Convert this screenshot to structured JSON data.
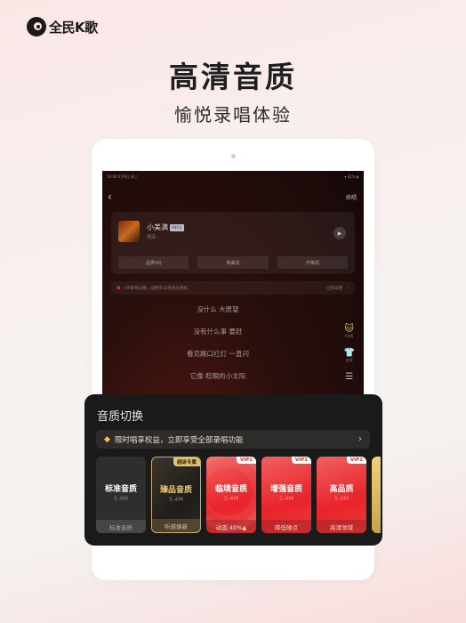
{
  "brand": {
    "logo_icon": "quanmin-k-ge-logo-icon",
    "name": "全民K歌"
  },
  "hero": {
    "title": "高清音质",
    "subtitle": "愉悦录唱体验"
  },
  "device_screen": {
    "status_bar": {
      "left": "10:04 6月9日 周三",
      "right": "▾ 42% ▮"
    },
    "nav": {
      "back_icon": "chevron-left-icon",
      "action": "练唱"
    },
    "song": {
      "title": "小美满",
      "tag": "AI打分",
      "artist": "周深 ›",
      "play_icon": "play-icon",
      "options": [
        "品质HQ",
        "换曲风",
        "升降调"
      ]
    },
    "vip_notice": {
      "text": "VIP即将过期，续费享10项会员特权",
      "action": "立即续费",
      "chevron": "›"
    },
    "lyrics": [
      "没什么 大愿望",
      "没有什么事 要赶",
      "看见路口红灯 一直闪",
      "它像 眨眼的小太阳"
    ],
    "side_tools": [
      {
        "icon": "cat-avatar-icon",
        "label": "KK周"
      },
      {
        "icon": "shirt-icon",
        "label": "皮肤"
      },
      {
        "icon": "menu-icon",
        "label": ""
      }
    ]
  },
  "quality_sheet": {
    "title": "音质切换",
    "promo": {
      "icon": "diamond-icon",
      "text": "限时唱享权益，立即享受全部录唱功能",
      "chevron": "›"
    },
    "options": [
      {
        "name": "标准音质",
        "size": "5.4M",
        "desc": "标准音质",
        "badge": "",
        "style": "standard"
      },
      {
        "name": "臻品音质",
        "size": "5.4M",
        "desc": "听感焕新",
        "badge": "超级专属",
        "style": "gold"
      },
      {
        "name": "临境音质",
        "size": "5.4M",
        "desc": "动态 40%▲",
        "badge": "VIP1",
        "style": "red"
      },
      {
        "name": "增强音质",
        "size": "5.4M",
        "desc": "降低噪点",
        "badge": "VIP1",
        "style": "red"
      },
      {
        "name": "高品质",
        "size": "5.4M",
        "desc": "高清领域",
        "badge": "VIP1",
        "style": "red"
      }
    ]
  }
}
